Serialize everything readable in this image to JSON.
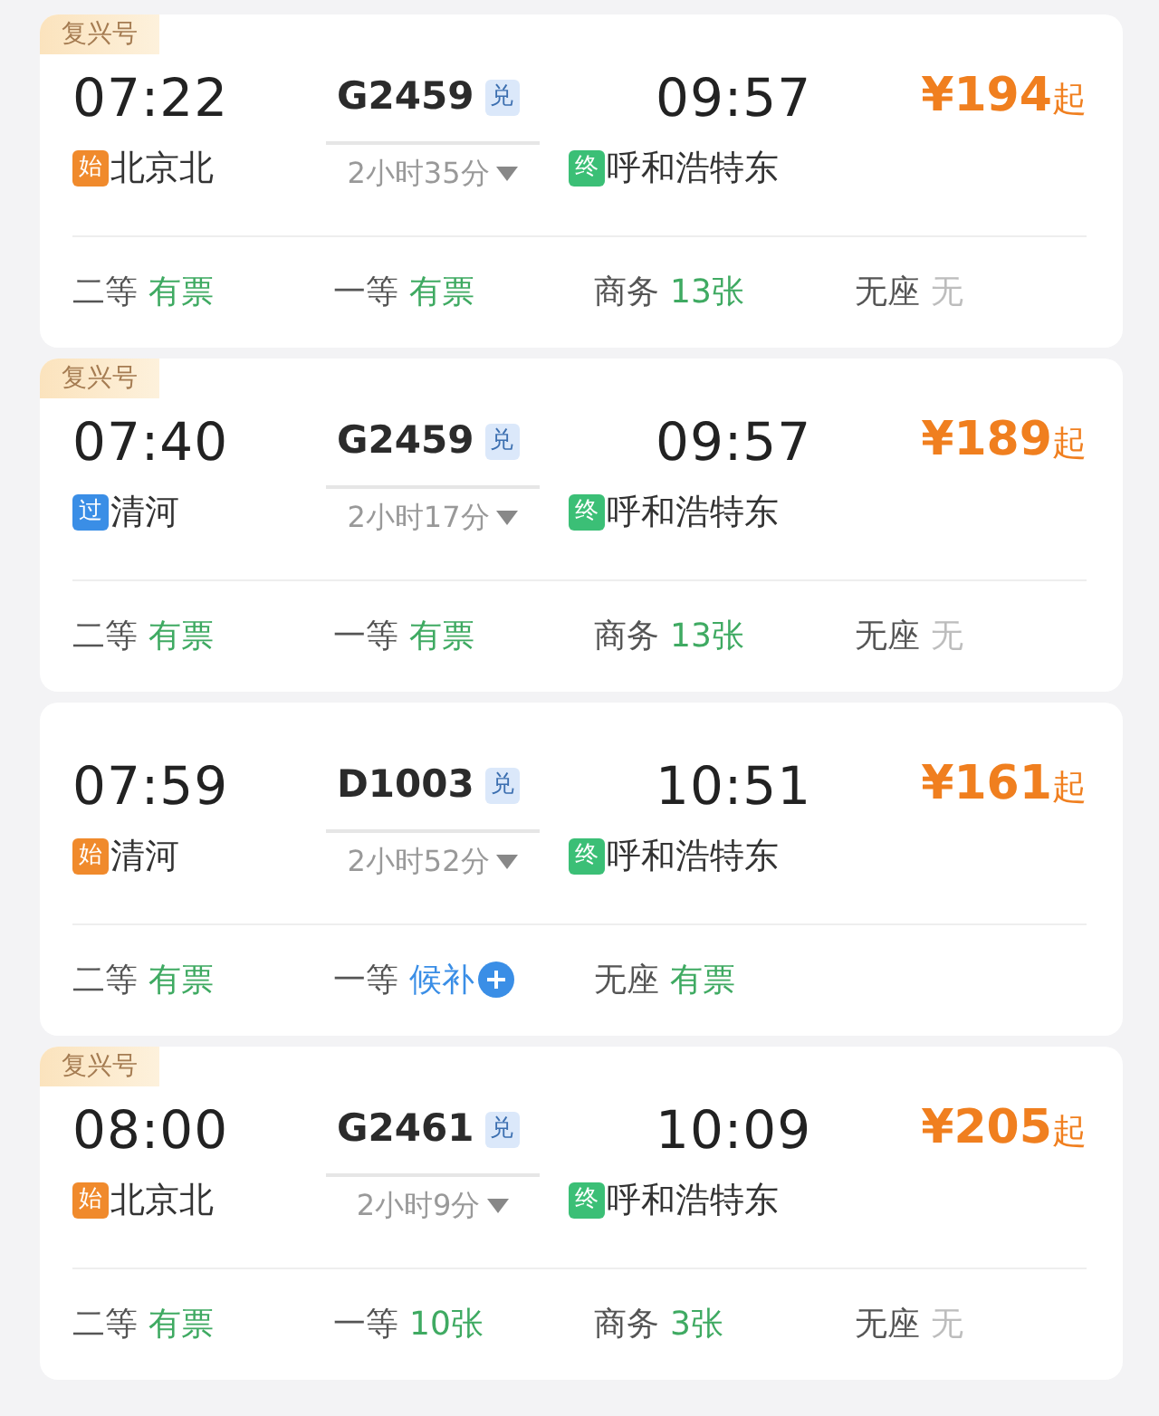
{
  "trains": [
    {
      "badge": "复兴号",
      "depart_time": "07:22",
      "train_no": "G2459",
      "tag": "兑",
      "arrive_time": "09:57",
      "price": "¥194",
      "price_suffix": "起",
      "from": {
        "kind": "origin",
        "marker": "始",
        "name": "北京北"
      },
      "duration": "2小时35分",
      "to": {
        "kind": "terminal",
        "marker": "终",
        "name": "呼和浩特东"
      },
      "seats": [
        {
          "class": "二等",
          "status": "有票",
          "kind": "available"
        },
        {
          "class": "一等",
          "status": "有票",
          "kind": "available"
        },
        {
          "class": "商务",
          "status": "13张",
          "kind": "available"
        },
        {
          "class": "无座",
          "status": "无",
          "kind": "none"
        }
      ]
    },
    {
      "badge": "复兴号",
      "depart_time": "07:40",
      "train_no": "G2459",
      "tag": "兑",
      "arrive_time": "09:57",
      "price": "¥189",
      "price_suffix": "起",
      "from": {
        "kind": "passing",
        "marker": "过",
        "name": "清河"
      },
      "duration": "2小时17分",
      "to": {
        "kind": "terminal",
        "marker": "终",
        "name": "呼和浩特东"
      },
      "seats": [
        {
          "class": "二等",
          "status": "有票",
          "kind": "available"
        },
        {
          "class": "一等",
          "status": "有票",
          "kind": "available"
        },
        {
          "class": "商务",
          "status": "13张",
          "kind": "available"
        },
        {
          "class": "无座",
          "status": "无",
          "kind": "none"
        }
      ]
    },
    {
      "depart_time": "07:59",
      "train_no": "D1003",
      "tag": "兑",
      "arrive_time": "10:51",
      "price": "¥161",
      "price_suffix": "起",
      "from": {
        "kind": "origin",
        "marker": "始",
        "name": "清河"
      },
      "duration": "2小时52分",
      "to": {
        "kind": "terminal",
        "marker": "终",
        "name": "呼和浩特东"
      },
      "seats": [
        {
          "class": "二等",
          "status": "有票",
          "kind": "available"
        },
        {
          "class": "一等",
          "status": "候补",
          "kind": "waitlist"
        },
        {
          "class": "无座",
          "status": "有票",
          "kind": "available"
        }
      ]
    },
    {
      "badge": "复兴号",
      "depart_time": "08:00",
      "train_no": "G2461",
      "tag": "兑",
      "arrive_time": "10:09",
      "price": "¥205",
      "price_suffix": "起",
      "from": {
        "kind": "origin",
        "marker": "始",
        "name": "北京北"
      },
      "duration": "2小时9分",
      "to": {
        "kind": "terminal",
        "marker": "终",
        "name": "呼和浩特东"
      },
      "seats": [
        {
          "class": "二等",
          "status": "有票",
          "kind": "available"
        },
        {
          "class": "一等",
          "status": "10张",
          "kind": "available"
        },
        {
          "class": "商务",
          "status": "3张",
          "kind": "available"
        },
        {
          "class": "无座",
          "status": "无",
          "kind": "none"
        }
      ]
    }
  ]
}
